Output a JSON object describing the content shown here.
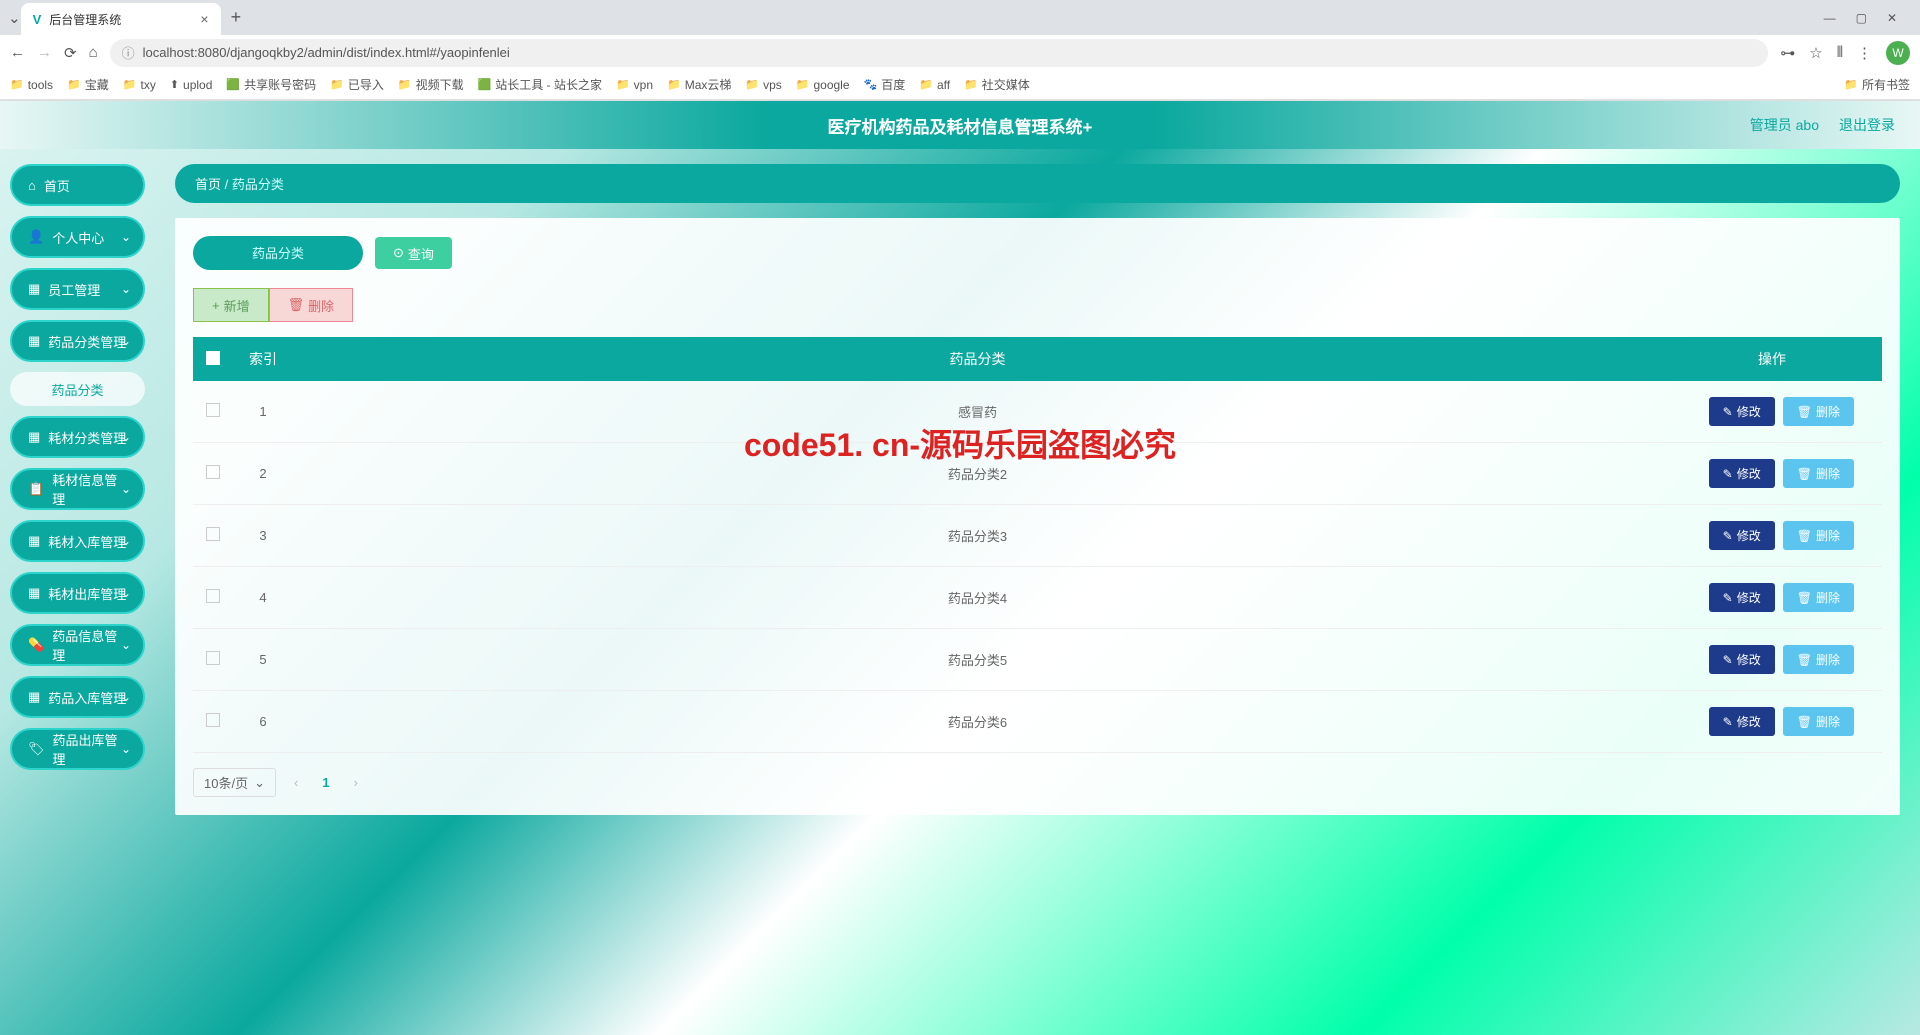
{
  "browser": {
    "tab_title": "后台管理系统",
    "url": "localhost:8080/djangoqkby2/admin/dist/index.html#/yaopinfenlei",
    "avatar_letter": "W",
    "all_bookmarks": "所有书签",
    "bookmarks": [
      {
        "icon": "📁",
        "label": "tools"
      },
      {
        "icon": "📁",
        "label": "宝藏"
      },
      {
        "icon": "📁",
        "label": "txy"
      },
      {
        "icon": "⬆",
        "label": "uplod"
      },
      {
        "icon": "🟩",
        "label": "共享账号密码"
      },
      {
        "icon": "📁",
        "label": "已导入"
      },
      {
        "icon": "📁",
        "label": "视频下载"
      },
      {
        "icon": "🟩",
        "label": "站长工具 - 站长之家"
      },
      {
        "icon": "📁",
        "label": "vpn"
      },
      {
        "icon": "📁",
        "label": "Max云梯"
      },
      {
        "icon": "📁",
        "label": "vps"
      },
      {
        "icon": "📁",
        "label": "google"
      },
      {
        "icon": "🐾",
        "label": "百度"
      },
      {
        "icon": "📁",
        "label": "aff"
      },
      {
        "icon": "📁",
        "label": "社交媒体"
      }
    ]
  },
  "header": {
    "title": "医疗机构药品及耗材信息管理系统+",
    "user_label": "管理员 abo",
    "logout": "退出登录"
  },
  "sidebar": {
    "items": [
      {
        "icon": "⌂",
        "label": "首页",
        "chevron": false
      },
      {
        "icon": "👤",
        "label": "个人中心",
        "chevron": true
      },
      {
        "icon": "▦",
        "label": "员工管理",
        "chevron": true
      },
      {
        "icon": "▦",
        "label": "药品分类管理",
        "chevron": true
      },
      {
        "icon": "▦",
        "label": "耗材分类管理",
        "chevron": true
      },
      {
        "icon": "📋",
        "label": "耗材信息管理",
        "chevron": true
      },
      {
        "icon": "▦",
        "label": "耗材入库管理",
        "chevron": true
      },
      {
        "icon": "▦",
        "label": "耗材出库管理",
        "chevron": true
      },
      {
        "icon": "💊",
        "label": "药品信息管理",
        "chevron": true
      },
      {
        "icon": "▦",
        "label": "药品入库管理",
        "chevron": true
      },
      {
        "icon": "🏷",
        "label": "药品出库管理",
        "chevron": true
      }
    ],
    "sub_item": "药品分类"
  },
  "breadcrumb": {
    "home": "首页",
    "current": "药品分类"
  },
  "search": {
    "placeholder": "药品分类",
    "query_btn": "查询"
  },
  "actions": {
    "add": "新增",
    "delete": "删除"
  },
  "table": {
    "headers": {
      "index": "索引",
      "category": "药品分类",
      "actions": "操作"
    },
    "row_btn": {
      "edit": "修改",
      "delete": "删除"
    },
    "rows": [
      {
        "idx": "1",
        "name": "感冒药"
      },
      {
        "idx": "2",
        "name": "药品分类2"
      },
      {
        "idx": "3",
        "name": "药品分类3"
      },
      {
        "idx": "4",
        "name": "药品分类4"
      },
      {
        "idx": "5",
        "name": "药品分类5"
      },
      {
        "idx": "6",
        "name": "药品分类6"
      }
    ]
  },
  "pagination": {
    "page_size": "10条/页",
    "current": "1"
  },
  "watermark": "code51. cn-源码乐园盗图必究"
}
